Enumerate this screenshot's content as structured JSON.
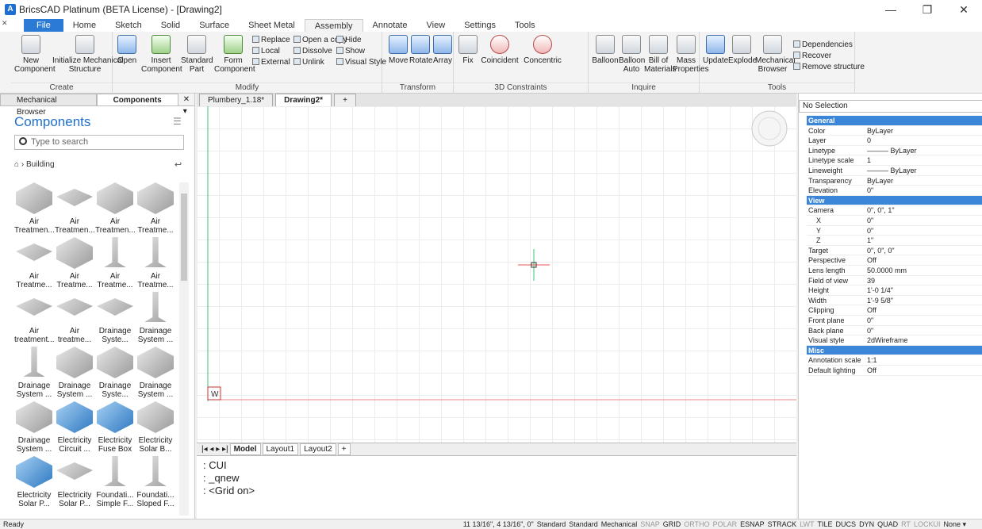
{
  "window": {
    "title": "BricsCAD Platinum (BETA License) - [Drawing2]",
    "minimize": "—",
    "restore": "❐",
    "close": "✕"
  },
  "menu": {
    "close_x": "✕",
    "tabs": [
      "File",
      "Home",
      "Sketch",
      "Solid",
      "Surface",
      "Sheet Metal",
      "Assembly",
      "Annotate",
      "View",
      "Settings",
      "Tools"
    ]
  },
  "ribbon": {
    "create": {
      "title": "Create",
      "new": "New\nComponent",
      "init": "Initialize Mechanical\nStructure"
    },
    "modify": {
      "title": "Modify",
      "open": "Open",
      "insert": "Insert\nComponent",
      "standard": "Standard\nPart",
      "form": "Form\nComponent",
      "replace": "Replace",
      "local": "Local",
      "external": "External",
      "open_copy": "Open a copy",
      "dissolve": "Dissolve",
      "unlink": "Unlink",
      "hide": "Hide",
      "show": "Show",
      "visual_style": "Visual Style"
    },
    "transform": {
      "title": "Transform",
      "move": "Move",
      "rotate": "Rotate",
      "array": "Array"
    },
    "constraints": {
      "title": "3D Constraints",
      "fix": "Fix",
      "coincident": "Coincident",
      "concentric": "Concentric"
    },
    "inquire": {
      "title": "Inquire",
      "balloon": "Balloon",
      "balloon_auto": "Balloon\nAuto",
      "bom": "Bill of\nMaterials",
      "mass": "Mass\nProperties"
    },
    "tools": {
      "title": "Tools",
      "update": "Update",
      "explode": "Explode",
      "mech_browser": "Mechanical\nBrowser",
      "dependencies": "Dependencies",
      "recover": "Recover",
      "remove": "Remove structure"
    }
  },
  "left_panel": {
    "tabs": [
      "Mechanical Browser",
      "Components"
    ],
    "title": "Components",
    "search_placeholder": "Type to search",
    "breadcrumb": "Building",
    "items": [
      "Air\nTreatmen...",
      "Air\nTreatmen...",
      "Air\nTreatmen...",
      "Air\nTreatme...",
      "Air\nTreatme...",
      "Air\nTreatme...",
      "Air\nTreatme...",
      "Air\nTreatme...",
      "Air\ntreatment...",
      "Air\ntreatme...",
      "Drainage\nSyste...",
      "Drainage\nSystem ...",
      "Drainage\nSystem ...",
      "Drainage\nSystem ...",
      "Drainage\nSyste...",
      "Drainage\nSystem ...",
      "Drainage\nSystem ...",
      "Electricity\nCircuit ...",
      "Electricity\nFuse Box",
      "Electricity\nSolar B...",
      "Electricity\nSolar P...",
      "Electricity\nSolar P...",
      "Foundati...\nSimple F...",
      "Foundati...\nSloped F..."
    ]
  },
  "doc_tabs": [
    "Plumbery_1.18*",
    "Drawing2*"
  ],
  "doc_tab_add": "+",
  "layout_tabs": [
    "Model",
    "Layout1",
    "Layout2",
    "+"
  ],
  "ucs_label": "W",
  "command_lines": [
    ": CUI",
    ": _qnew",
    ": <Grid on>"
  ],
  "properties": {
    "selection": "No Selection",
    "rows": [
      {
        "k": "General",
        "v": "",
        "cat": true
      },
      {
        "k": "Color",
        "v": "ByLayer"
      },
      {
        "k": "Layer",
        "v": "0"
      },
      {
        "k": "Linetype",
        "v": "——— ByLayer"
      },
      {
        "k": "Linetype scale",
        "v": "1"
      },
      {
        "k": "Lineweight",
        "v": "——— ByLayer"
      },
      {
        "k": "Transparency",
        "v": "ByLayer"
      },
      {
        "k": "Elevation",
        "v": "0\""
      },
      {
        "k": "View",
        "v": "",
        "cat": true
      },
      {
        "k": "Camera",
        "v": "0\", 0\", 1\""
      },
      {
        "k": "X",
        "v": "0\"",
        "sub": true
      },
      {
        "k": "Y",
        "v": "0\"",
        "sub": true
      },
      {
        "k": "Z",
        "v": "1\"",
        "sub": true
      },
      {
        "k": "Target",
        "v": "0\", 0\", 0\""
      },
      {
        "k": "Perspective",
        "v": "Off"
      },
      {
        "k": "Lens length",
        "v": "50.0000 mm"
      },
      {
        "k": "Field of view",
        "v": "39"
      },
      {
        "k": "Height",
        "v": "1'-0 1/4\""
      },
      {
        "k": "Width",
        "v": "1'-9 5/8\""
      },
      {
        "k": "Clipping",
        "v": "Off"
      },
      {
        "k": "Front plane",
        "v": "0\""
      },
      {
        "k": "Back plane",
        "v": "0\""
      },
      {
        "k": "Visual style",
        "v": "2dWireframe"
      },
      {
        "k": "Misc",
        "v": "",
        "cat": true
      },
      {
        "k": "Annotation scale",
        "v": "1:1"
      },
      {
        "k": "Default lighting",
        "v": "Off"
      }
    ]
  },
  "status": {
    "left": "Ready",
    "coords": "11 13/16\", 4 13/16\", 0\"",
    "items": [
      "Standard",
      "Standard",
      "Mechanical",
      "SNAP",
      "GRID",
      "ORTHO",
      "POLAR",
      "ESNAP",
      "STRACK",
      "LWT",
      "TILE",
      "DUCS",
      "DYN",
      "QUAD",
      "RT",
      "LOCKUI",
      "None ▾"
    ],
    "off": [
      "SNAP",
      "ORTHO",
      "POLAR",
      "LWT",
      "RT",
      "LOCKUI"
    ]
  }
}
